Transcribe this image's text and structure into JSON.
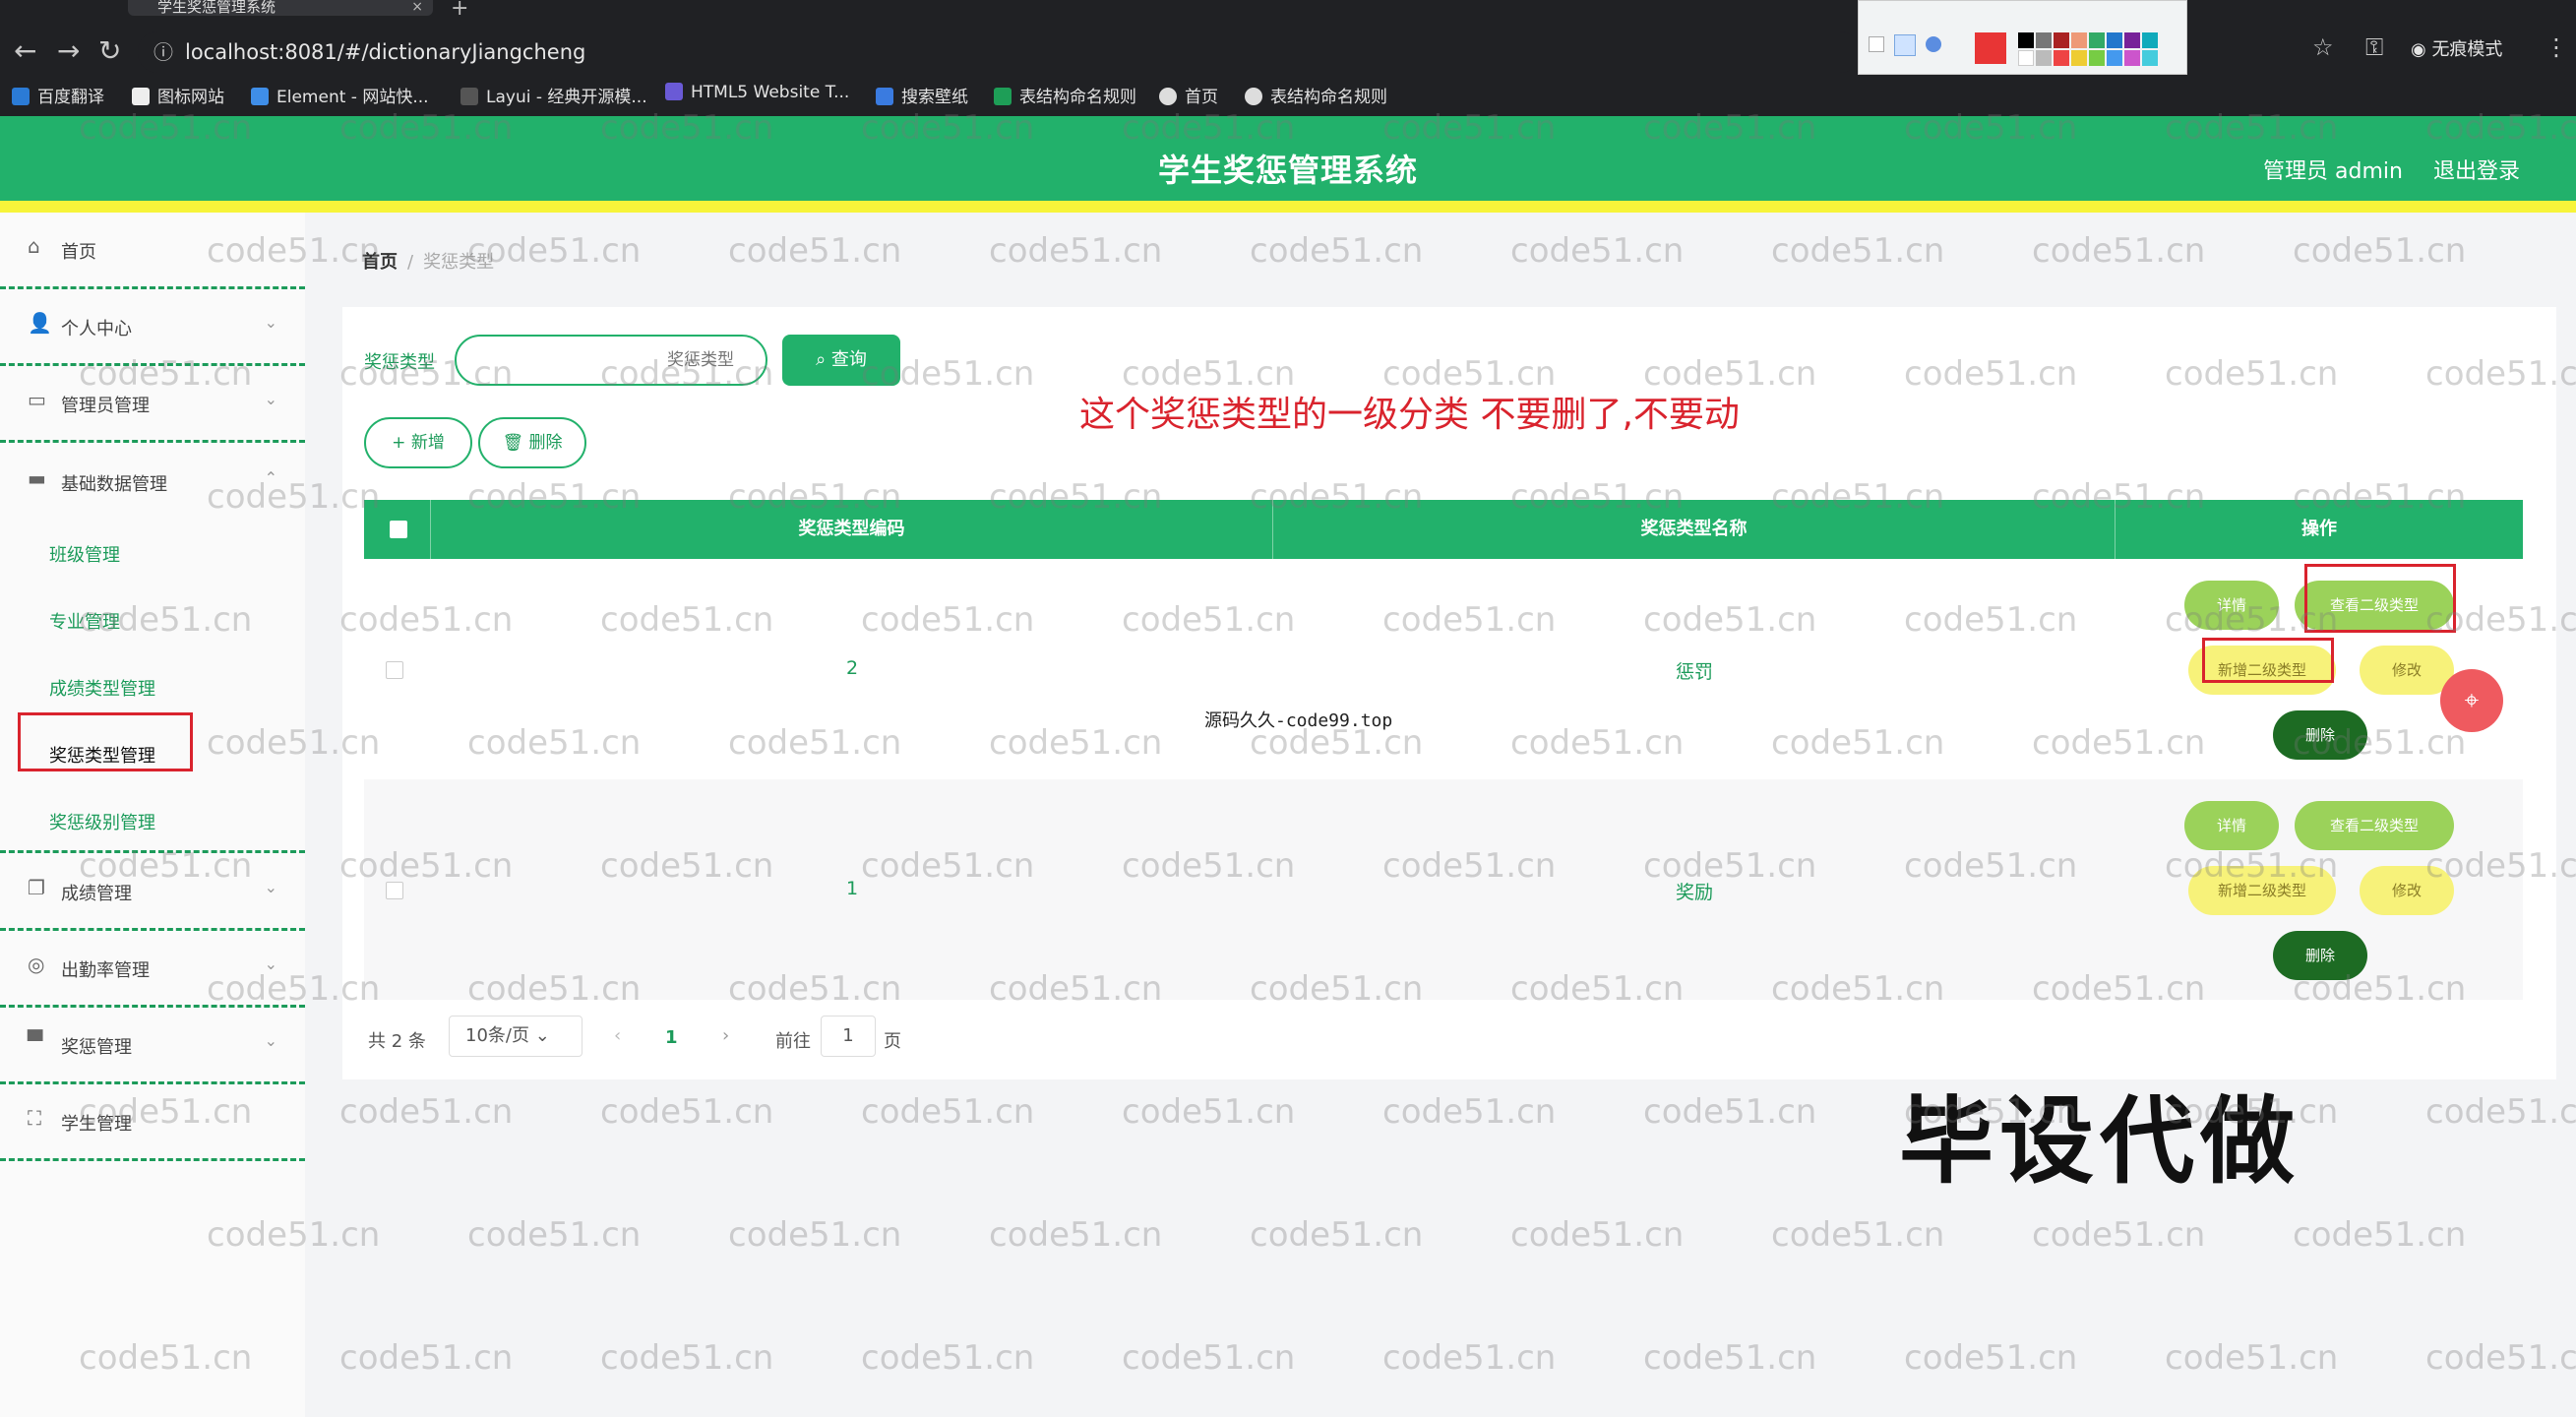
{
  "browser": {
    "tab_title": "学生奖惩管理系统",
    "tab_close": "×",
    "new_tab": "+",
    "url": "localhost:8081/#/dictionaryJiangcheng",
    "incognito_label": "无痕模式",
    "bookmarks": [
      "百度翻译",
      "图标网站",
      "Element - 网站快...",
      "Layui - 经典开源模...",
      "HTML5 Website T...",
      "搜索壁纸",
      "表结构命名规则",
      "首页",
      "表结构命名规则"
    ]
  },
  "app": {
    "title": "学生奖惩管理系统",
    "admin": "管理员 admin",
    "logout": "退出登录"
  },
  "sidebar": {
    "items": [
      {
        "label": "首页",
        "icon": "home-icon"
      },
      {
        "label": "个人中心",
        "icon": "user-icon"
      },
      {
        "label": "管理员管理",
        "icon": "chat-icon"
      },
      {
        "label": "基础数据管理",
        "icon": "chat-icon"
      },
      {
        "label": "成绩管理",
        "icon": "copy-icon"
      },
      {
        "label": "出勤率管理",
        "icon": "compass-icon"
      },
      {
        "label": "奖惩管理",
        "icon": "monitor-icon"
      },
      {
        "label": "学生管理",
        "icon": "fullscreen-icon"
      }
    ],
    "subitems": [
      "班级管理",
      "专业管理",
      "成绩类型管理",
      "奖惩类型管理",
      "奖惩级别管理"
    ]
  },
  "breadcrumb": {
    "home": "首页",
    "separator": "/",
    "current": "奖惩类型"
  },
  "filter": {
    "label": "奖惩类型",
    "placeholder": "奖惩类型",
    "query": "查询"
  },
  "actions": {
    "add": "+ 新增",
    "delete": "删除"
  },
  "annotation": "这个奖惩类型的一级分类 不要删了,不要动",
  "table": {
    "headers": [
      "奖惩类型编码",
      "奖惩类型名称",
      "操作"
    ],
    "rows": [
      {
        "code": "2",
        "name": "惩罚"
      },
      {
        "code": "1",
        "name": "奖励"
      }
    ],
    "ops": {
      "detail": "详情",
      "view_sub": "查看二级类型",
      "add_sub": "新增二级类型",
      "edit": "修改",
      "delete": "删除"
    }
  },
  "pagination": {
    "total": "共 2 条",
    "page_size": "10条/页",
    "current": "1",
    "goto": "前往",
    "jump": "1",
    "unit": "页"
  },
  "overlay": {
    "site": "源码久久-code99.top",
    "promo": "毕设代做",
    "watermark": "code51.cn"
  },
  "colors": {
    "primary": "#22b16b",
    "accent_yellow": "#f7f43a",
    "annotation_red": "#d9232d"
  }
}
